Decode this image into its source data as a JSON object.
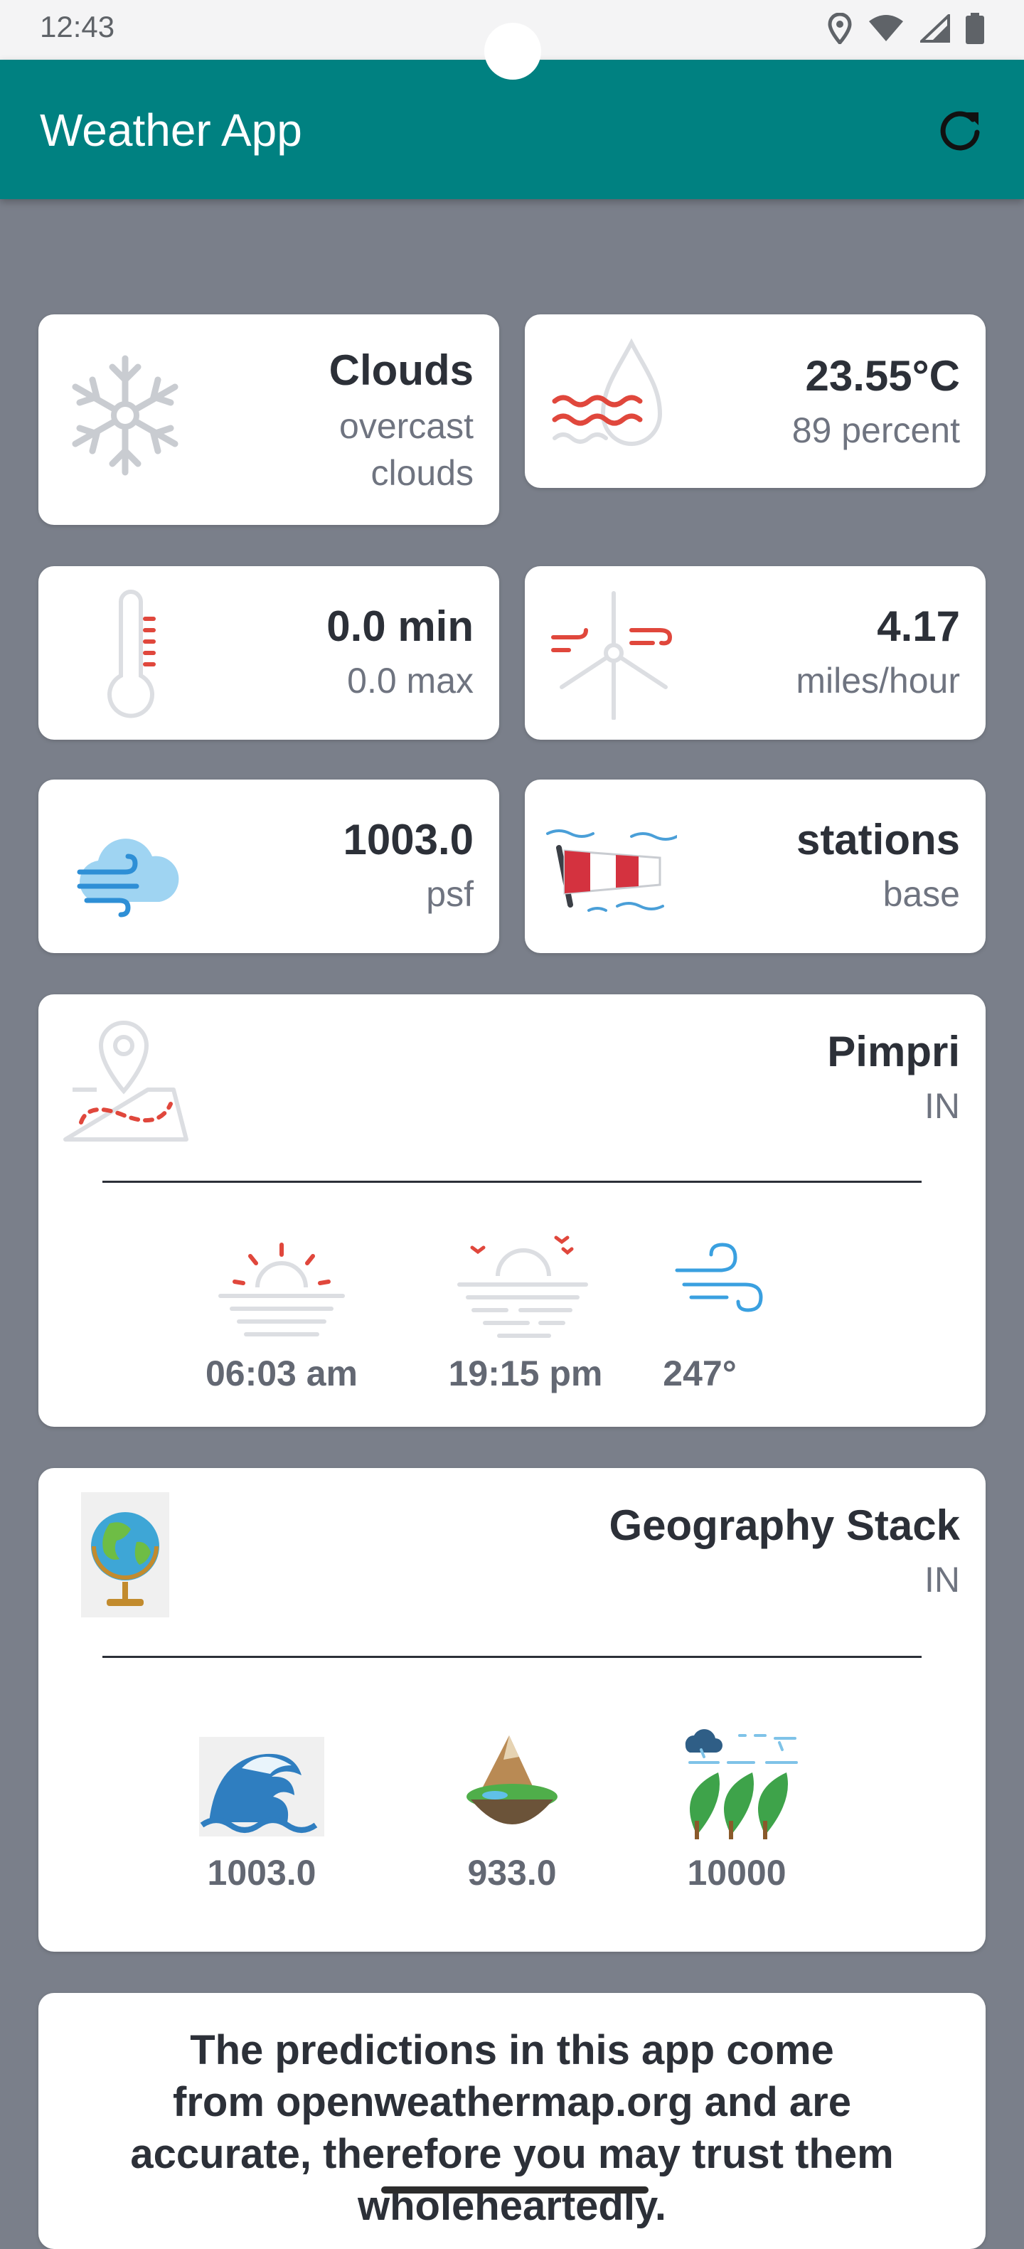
{
  "status_bar": {
    "time": "12:43"
  },
  "app_bar": {
    "title": "Weather App",
    "refresh_icon": "refresh-icon"
  },
  "cards": {
    "conditions": {
      "main": "Clouds",
      "description_line1": "overcast",
      "description_line2": "clouds",
      "icon": "snowflake-icon"
    },
    "humidity": {
      "temperature": "23.55°C",
      "humidity": "89 percent",
      "icon": "humidity-drop-icon"
    },
    "min_max": {
      "min": "0.0 min",
      "max": "0.0 max",
      "icon": "thermometer-icon"
    },
    "wind": {
      "speed": "4.17",
      "unit": "miles/hour",
      "icon": "wind-turbine-icon"
    },
    "pressure": {
      "value": "1003.0",
      "unit": "psf",
      "icon": "cloud-wind-icon"
    },
    "stations": {
      "value": "stations",
      "label": "base",
      "icon": "windsock-icon"
    }
  },
  "location": {
    "city": "Pimpri",
    "country": "IN",
    "sunrise": "06:03 am",
    "sunset": "19:15 pm",
    "wind_direction": "247°"
  },
  "geography": {
    "title": "Geography Stack",
    "country": "IN",
    "sea_level": "1003.0",
    "ground_level": "933.0",
    "visibility": "10000"
  },
  "info": {
    "line1": "The predictions in this app come",
    "line2": "from openweathermap.org and are",
    "line3": "accurate, therefore you may trust them",
    "line4": "wholeheartedly."
  },
  "colors": {
    "app_bar": "#008181",
    "background": "#7a7f8a",
    "accent_red": "#e0473c",
    "icon_grey": "#c9ccd1",
    "icon_blue": "#3aa0e0"
  }
}
